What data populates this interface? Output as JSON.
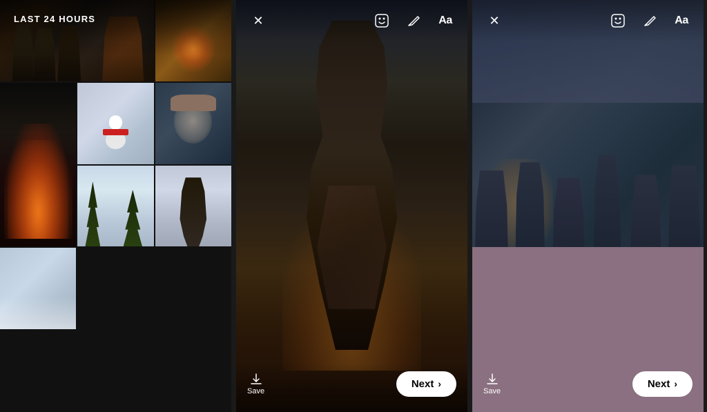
{
  "gallery": {
    "title": "LAST 24 HOURS",
    "photos": [
      {
        "id": "p1",
        "desc": "group of people outdoors at night",
        "class": "p1 span2h"
      },
      {
        "id": "p2",
        "desc": "campfire with sparks",
        "class": "p2"
      },
      {
        "id": "p3",
        "desc": "campfire close up",
        "class": "p3 span2v"
      },
      {
        "id": "p4",
        "desc": "snowman with red scarf",
        "class": "p4"
      },
      {
        "id": "p5",
        "desc": "woman in winter hat selfie",
        "class": "p5"
      },
      {
        "id": "p6",
        "desc": "snowy forest trees",
        "class": "p6"
      },
      {
        "id": "p7",
        "desc": "woman in winter coat",
        "class": "p7"
      },
      {
        "id": "p8",
        "desc": "snowy landscape",
        "class": "p8"
      }
    ]
  },
  "middle_panel": {
    "photo_desc": "Person in dark jacket looking up at marshmallow on stick",
    "header": {
      "close_icon": "✕",
      "sticker_icon": "☺",
      "draw_icon": "✏",
      "text_icon": "Aa"
    },
    "footer": {
      "save_label": "Save",
      "next_label": "Next",
      "chevron": "›"
    }
  },
  "right_panel": {
    "photo_desc": "Group of people roasting marshmallows in snow at night - collage style",
    "header": {
      "close_icon": "✕",
      "sticker_icon": "☺",
      "draw_icon": "✏",
      "text_icon": "Aa"
    },
    "footer": {
      "save_label": "Save",
      "next_label": "Next",
      "chevron": "›"
    },
    "background_color": "#8a7080"
  }
}
